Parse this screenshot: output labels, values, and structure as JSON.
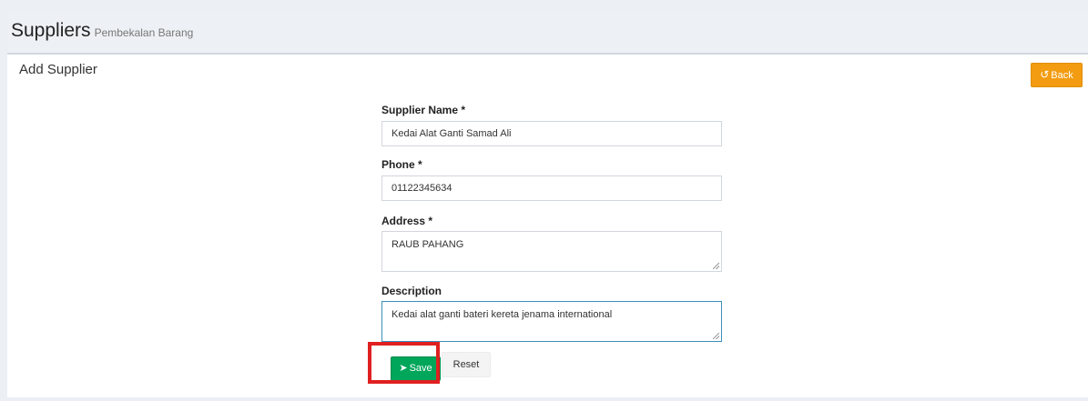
{
  "header": {
    "title": "Suppliers",
    "subtitle": "Pembekalan Barang"
  },
  "box": {
    "title": "Add Supplier",
    "back_label": "Back",
    "back_icon": "undo-icon"
  },
  "form": {
    "supplier_name": {
      "label": "Supplier Name *",
      "value": "Kedai Alat Ganti Samad Ali"
    },
    "phone": {
      "label": "Phone *",
      "value": "01122345634"
    },
    "address": {
      "label": "Address *",
      "value": "RAUB PAHANG"
    },
    "description": {
      "label": "Description",
      "value": "Kedai alat ganti bateri kereta jenama international"
    }
  },
  "buttons": {
    "save_label": "Save",
    "save_icon": "paper-plane-icon",
    "reset_label": "Reset"
  },
  "colors": {
    "back_button": "#f39c12",
    "save_button": "#00a65a",
    "highlight": "#e02020",
    "focus_border": "#3c8dbc"
  }
}
